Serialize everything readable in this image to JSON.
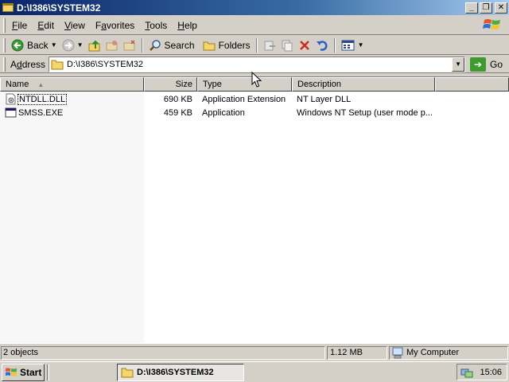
{
  "window": {
    "title": "D:\\I386\\SYSTEM32"
  },
  "title_buttons": {
    "minimize": "_",
    "maximize": "❐",
    "close": "✕"
  },
  "menu": [
    {
      "label": "File",
      "key": "F",
      "rest": "ile"
    },
    {
      "label": "Edit",
      "key": "E",
      "rest": "dit"
    },
    {
      "label": "View",
      "key": "V",
      "rest": "iew"
    },
    {
      "label": "Favorites",
      "key": "a",
      "pre": "F",
      "rest": "vorites"
    },
    {
      "label": "Tools",
      "key": "T",
      "rest": "ools"
    },
    {
      "label": "Help",
      "key": "H",
      "rest": "elp"
    }
  ],
  "toolbar": {
    "back_label": "Back",
    "search_label": "Search",
    "folders_label": "Folders"
  },
  "address": {
    "label_key": "d",
    "label_pre": "A",
    "label_rest": "dress",
    "value": "D:\\I386\\SYSTEM32",
    "go_label": "Go"
  },
  "columns": {
    "name": "Name",
    "size": "Size",
    "type": "Type",
    "description": "Description"
  },
  "sort": {
    "column": "Name",
    "direction": "ascending"
  },
  "files": [
    {
      "name": "NTDLL.DLL",
      "size": "690 KB",
      "type": "Application Extension",
      "description": "NT Layer DLL",
      "icon": "dll-file-icon",
      "focused": true
    },
    {
      "name": "SMSS.EXE",
      "size": "459 KB",
      "type": "Application",
      "description": "Windows NT Setup (user mode p...",
      "icon": "exe-file-icon",
      "focused": false
    }
  ],
  "status": {
    "objects": "2 objects",
    "size": "1.12 MB",
    "zone": "My Computer"
  },
  "taskbar": {
    "start_label": "Start",
    "task_label": "D:\\I386\\SYSTEM32",
    "clock": "15:06"
  },
  "colors": {
    "title_gradient_start": "#0a246a",
    "title_gradient_end": "#a6caf0",
    "face": "#d4d0c8",
    "go_green": "#3c9a2f"
  }
}
